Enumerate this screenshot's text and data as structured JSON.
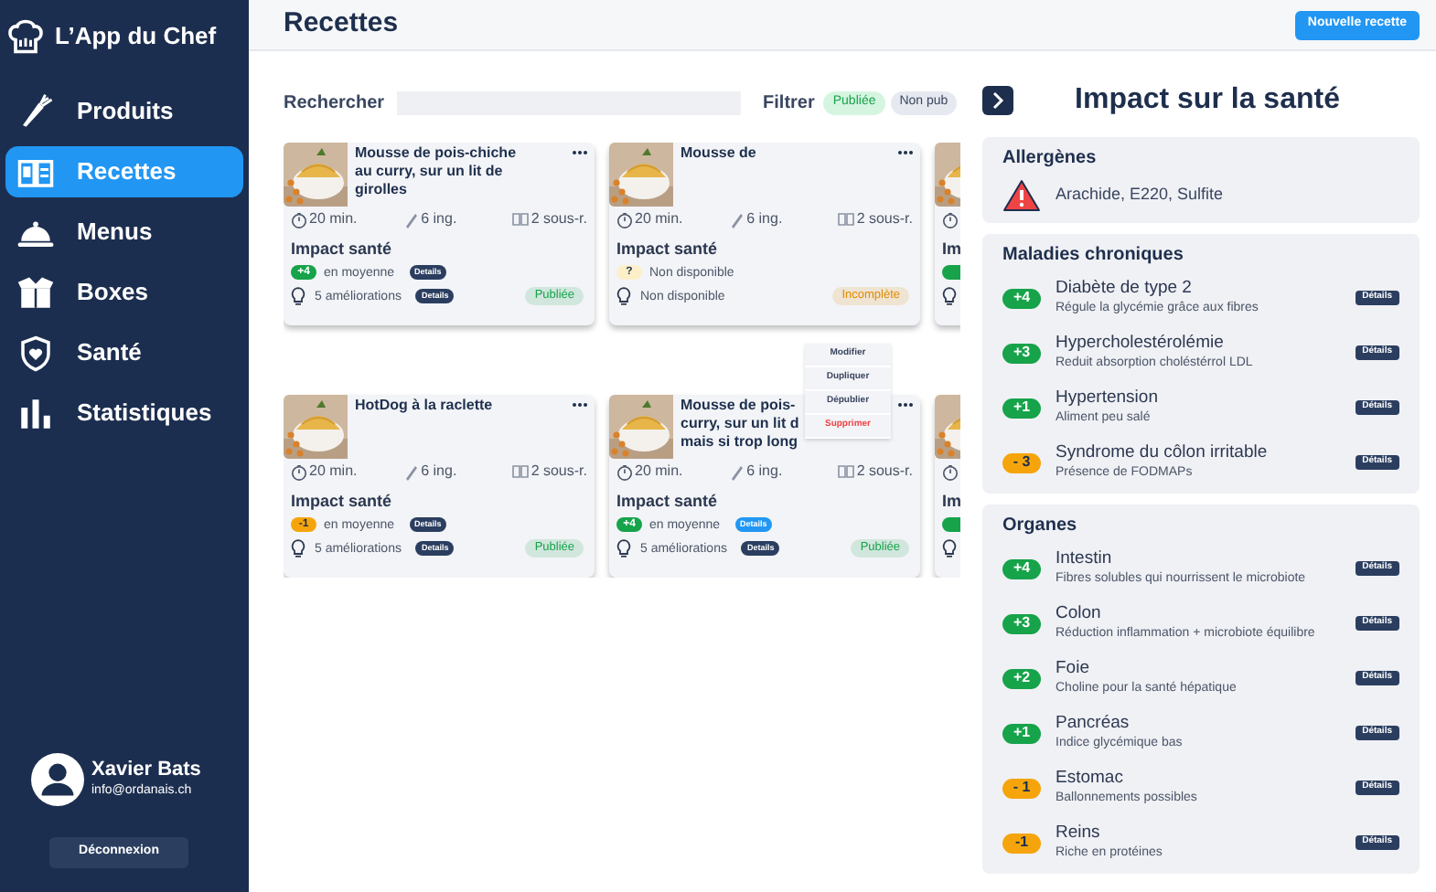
{
  "app": {
    "name": "L’App du Chef"
  },
  "nav": [
    {
      "label": "Produits",
      "selected": false
    },
    {
      "label": "Recettes",
      "selected": true
    },
    {
      "label": "Menus",
      "selected": false
    },
    {
      "label": "Boxes",
      "selected": false
    },
    {
      "label": "Santé",
      "selected": false
    },
    {
      "label": "Statistiques",
      "selected": false
    }
  ],
  "user": {
    "name": "Xavier Bats",
    "email": "info@ordanais.ch",
    "logout": "Déconnexion"
  },
  "header": {
    "title": "Recettes",
    "new_button": "Nouvelle recette"
  },
  "search": {
    "label": "Rechercher"
  },
  "filter": {
    "label": "Filtrer",
    "chips": [
      {
        "label": "Publiée",
        "selected": true
      },
      {
        "label": "Non pub",
        "selected": false
      }
    ]
  },
  "cards": [
    {
      "kind": "full",
      "title_lines": [
        "Mousse de pois-chiche",
        "au curry, sur un lit de",
        "girolles"
      ],
      "time": "20 min.",
      "ingredients": "6 ing.",
      "subrecipes": "2 sous-r.",
      "impact_label": "Impact santé",
      "score": {
        "text": "+4",
        "color": "#16a34a"
      },
      "score_text": "en moyenne",
      "score_details": {
        "label": "Details",
        "highlighted": false
      },
      "improvements": "5 améliorations",
      "improvements_details": {
        "label": "Details",
        "highlighted": false
      },
      "status": {
        "text": "Publiée",
        "color": "#16a34a"
      }
    },
    {
      "kind": "full",
      "title_lines": [
        "Mousse de"
      ],
      "time": "20 min.",
      "ingredients": "6 ing.",
      "subrecipes": "2 sous-r.",
      "impact_label": "Impact santé",
      "score": {
        "text": "?",
        "color": "#fdefc8"
      },
      "score_text": "Non disponible",
      "improvements": "Non disponible",
      "status": {
        "text": "Incomplète",
        "color": "#e08a00"
      }
    },
    {
      "kind": "partial",
      "impact_label": "Im",
      "score": {
        "color": "#16a34a"
      }
    },
    {
      "kind": "full",
      "title_lines": [
        "HotDog à la raclette"
      ],
      "time": "20 min.",
      "ingredients": "6 ing.",
      "subrecipes": "2 sous-r.",
      "impact_label": "Impact santé",
      "score": {
        "text": "-1",
        "color": "#f5a50b"
      },
      "score_text": "en moyenne",
      "score_details": {
        "label": "Details",
        "highlighted": false
      },
      "improvements": "5 améliorations",
      "improvements_details": {
        "label": "Details",
        "highlighted": false
      },
      "status": {
        "text": "Publiée",
        "color": "#16a34a"
      }
    },
    {
      "kind": "full",
      "title_lines": [
        "Mousse de pois-",
        "curry, sur un lit d",
        "mais si trop long"
      ],
      "time": "20 min.",
      "ingredients": "6 ing.",
      "subrecipes": "2 sous-r.",
      "impact_label": "Impact santé",
      "score": {
        "text": "+4",
        "color": "#16a34a"
      },
      "score_text": "en moyenne",
      "score_details": {
        "label": "Details",
        "highlighted": true
      },
      "improvements": "5 améliorations",
      "improvements_details": {
        "label": "Details",
        "highlighted": false
      },
      "status": {
        "text": "Publiée",
        "color": "#16a34a"
      }
    },
    {
      "kind": "partial",
      "impact_label": "Im",
      "score": {
        "color": "#16a34a"
      }
    }
  ],
  "context_menu": [
    {
      "label": "Modifier",
      "kind": "normal"
    },
    {
      "label": "Dupliquer",
      "kind": "normal"
    },
    {
      "label": "Dépublier",
      "kind": "normal"
    },
    {
      "label": "Supprimer",
      "kind": "danger"
    }
  ],
  "panel": {
    "title": "Impact sur la santé",
    "allergens": {
      "heading": "Allergènes",
      "text": "Arachide, E220, Sulfite"
    },
    "sections": [
      {
        "heading": "Maladies chroniques",
        "rows": [
          {
            "score": "+4",
            "color": "#16a34a",
            "name": "Diabète de type 2",
            "description": "Régule la glycémie grâce aux fibres",
            "button": "Détails"
          },
          {
            "score": "+3",
            "color": "#16a34a",
            "name": "Hypercholestérolémie",
            "description": "Reduit absorption choléstérrol LDL",
            "button": "Détails"
          },
          {
            "score": "+1",
            "color": "#16a34a",
            "name": "Hypertension",
            "description": "Aliment peu salé",
            "button": "Détails"
          },
          {
            "score": "- 3",
            "color": "#f5a50b",
            "name": "Syndrome du côlon irritable",
            "description": "Présence de FODMAPs",
            "button": "Détails"
          }
        ]
      },
      {
        "heading": "Organes",
        "rows": [
          {
            "score": "+4",
            "color": "#16a34a",
            "name": "Intestin",
            "description": "Fibres solubles qui nourrissent le microbiote",
            "button": "Détails"
          },
          {
            "score": "+3",
            "color": "#16a34a",
            "name": "Colon",
            "description": "Réduction inflammation + microbiote équilibre",
            "button": "Détails"
          },
          {
            "score": "+2",
            "color": "#16a34a",
            "name": "Foie",
            "description": "Choline pour la santé hépatique",
            "button": "Détails"
          },
          {
            "score": "+1",
            "color": "#16a34a",
            "name": "Pancréas",
            "description": "Indice glycémique bas",
            "button": "Détails"
          },
          {
            "score": "- 1",
            "color": "#f5a50b",
            "name": "Estomac",
            "description": "Ballonnements possibles",
            "button": "Détails"
          },
          {
            "score": "-1",
            "color": "#f5a50b",
            "name": "Reins",
            "description": "Riche en protéines",
            "button": "Détails"
          }
        ]
      }
    ]
  }
}
